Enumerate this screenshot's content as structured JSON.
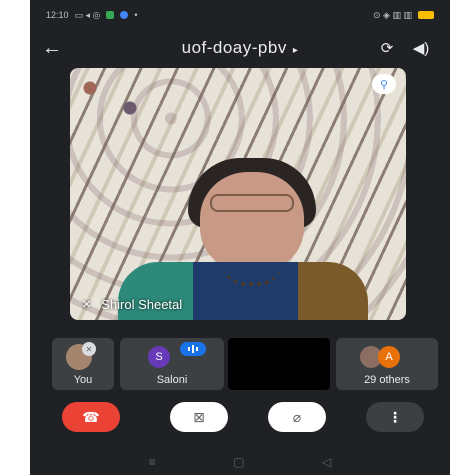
{
  "status_bar": {
    "time": "12:10"
  },
  "header": {
    "title": "uof-doay-pbv"
  },
  "main_video": {
    "participant_name": "Shirol Sheetal"
  },
  "tiles": [
    {
      "label": "You"
    },
    {
      "label": "Saloni",
      "avatar_letter": "S"
    },
    {
      "label": ""
    },
    {
      "label": "29 others",
      "avatar_letter": "A"
    }
  ],
  "colors": {
    "background": "#202124",
    "tile": "#3c4043",
    "end_call": "#ea4335",
    "accent": "#1a73e8"
  },
  "icons": {
    "back": "arrow-left-icon",
    "switch_camera": "camera-switch-icon",
    "speaker": "speaker-icon",
    "pin": "pin-icon",
    "end_call": "phone-hangup-icon",
    "camera_off": "camera-off-icon",
    "mic_off": "mic-off-icon",
    "more": "more-vert-icon"
  }
}
